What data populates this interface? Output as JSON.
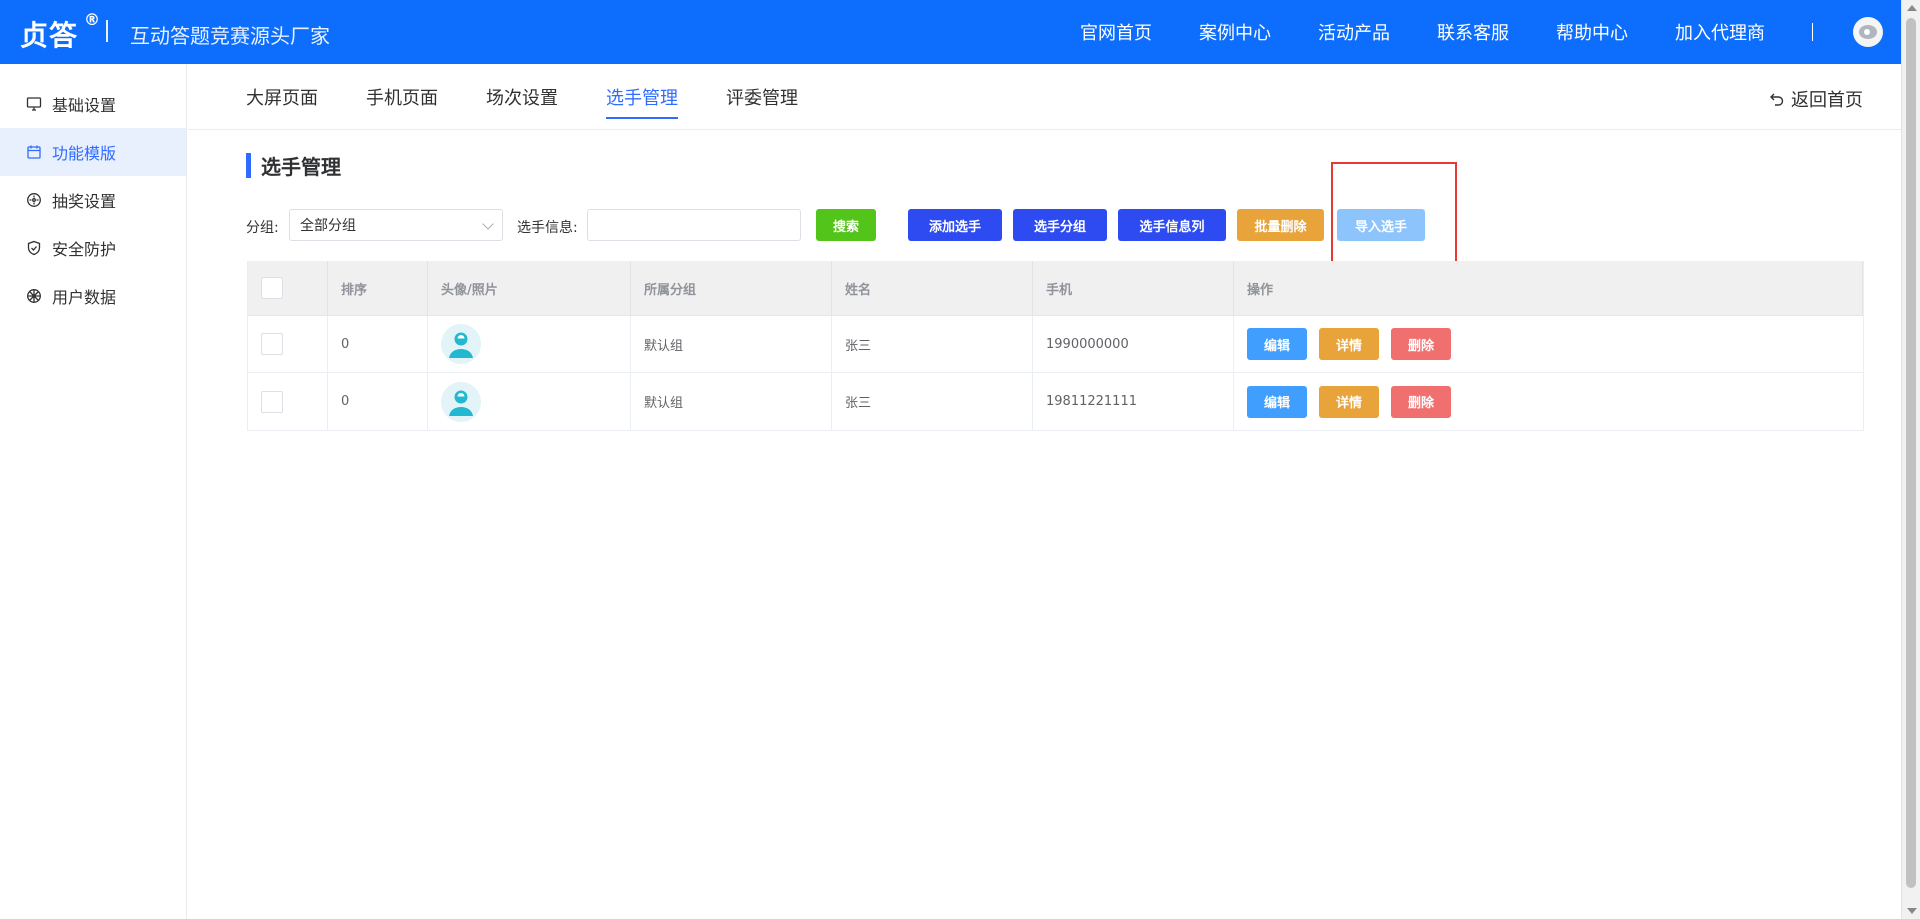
{
  "header": {
    "brand": "贞答",
    "registered": "®",
    "slogan": "互动答题竞赛源头厂家",
    "nav": [
      "官网首页",
      "案例中心",
      "活动产品",
      "联系客服",
      "帮助中心",
      "加入代理商"
    ],
    "background": "#0d6efd"
  },
  "sidebar": {
    "items": [
      {
        "label": "基础设置",
        "icon": "monitor-icon",
        "active": false
      },
      {
        "label": "功能模版",
        "icon": "calendar-icon",
        "active": true
      },
      {
        "label": "抽奖设置",
        "icon": "lottery-icon",
        "active": false
      },
      {
        "label": "安全防护",
        "icon": "shield-icon",
        "active": false
      },
      {
        "label": "用户数据",
        "icon": "user-data-icon",
        "active": false
      }
    ]
  },
  "tabs": {
    "items": [
      "大屏页面",
      "手机页面",
      "场次设置",
      "选手管理",
      "评委管理"
    ],
    "active_index": 3,
    "back_home": "返回首页"
  },
  "section": {
    "title": "选手管理"
  },
  "filter": {
    "group_label": "分组:",
    "group_selected": "全部分组",
    "info_label": "选手信息:",
    "info_value": "",
    "search_button": "搜索",
    "add_button": "添加选手",
    "group_button": "选手分组",
    "columns_button": "选手信息列",
    "batch_delete_button": "批量删除",
    "import_button": "导入选手"
  },
  "colors": {
    "accent": "#2f6bff",
    "search_green": "#52c41a",
    "primary_blue": "#2d4bf0",
    "orange": "#e8a33a",
    "import_light_blue": "#8cc4fb",
    "edit_blue": "#409eff",
    "delete_red": "#f07070",
    "highlight_red": "#e53935"
  },
  "table": {
    "headers": [
      "排序",
      "头像/照片",
      "所属分组",
      "姓名",
      "手机",
      "操作"
    ],
    "rows": [
      {
        "sort": "0",
        "group": "默认组",
        "name": "张三",
        "phone": "1990000000",
        "ops": [
          "编辑",
          "详情",
          "删除"
        ]
      },
      {
        "sort": "0",
        "group": "默认组",
        "name": "张三",
        "phone": "19811221111",
        "ops": [
          "编辑",
          "详情",
          "删除"
        ]
      }
    ]
  }
}
